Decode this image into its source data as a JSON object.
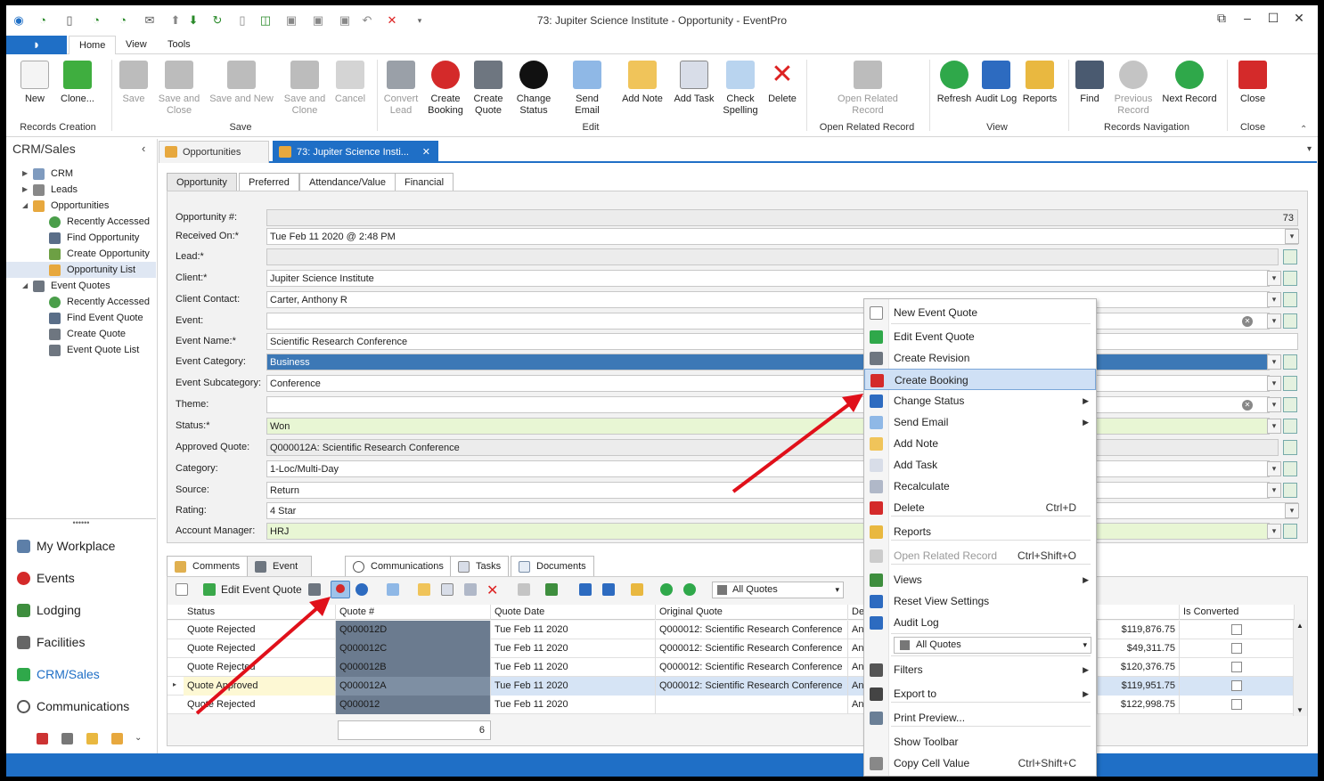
{
  "window": {
    "title": "73: Jupiter Science Institute - Opportunity - EventPro"
  },
  "menu": {
    "tabs": [
      "Home",
      "View",
      "Tools"
    ]
  },
  "ribbon": {
    "groups": [
      {
        "label": "Records Creation",
        "buttons": [
          "New",
          "Clone..."
        ]
      },
      {
        "label": "Save",
        "buttons": [
          "Save",
          "Save and Close",
          "Save and New",
          "Save and Clone",
          "Cancel"
        ]
      },
      {
        "label": "Edit",
        "buttons": [
          "Convert Lead",
          "Create Booking",
          "Create Quote",
          "Change Status",
          "Send Email",
          "Add Note",
          "Add Task",
          "Check Spelling",
          "Delete"
        ]
      },
      {
        "label": "Open Related Record",
        "buttons": [
          "Open Related Record"
        ]
      },
      {
        "label": "View",
        "buttons": [
          "Refresh",
          "Audit Log",
          "Reports"
        ]
      },
      {
        "label": "Records Navigation",
        "buttons": [
          "Find",
          "Previous Record",
          "Next Record"
        ]
      },
      {
        "label": "Close",
        "buttons": [
          "Close"
        ]
      }
    ]
  },
  "left_panel": {
    "title": "CRM/Sales",
    "tree": [
      "CRM",
      "Leads",
      "Opportunities",
      "Recently Accessed",
      "Find Opportunity",
      "Create Opportunity",
      "Opportunity List",
      "Event Quotes",
      "Recently Accessed",
      "Find Event Quote",
      "Create Quote",
      "Event Quote List"
    ],
    "nav": [
      "My Workplace",
      "Events",
      "Lodging",
      "Facilities",
      "CRM/Sales",
      "Communications"
    ]
  },
  "doc_tabs": [
    "Opportunities",
    "73: Jupiter Science Insti..."
  ],
  "form_tabs": [
    "Opportunity",
    "Preferred",
    "Attendance/Value",
    "Financial"
  ],
  "form": {
    "labels": [
      "Opportunity #:",
      "Received On:*",
      "Lead:*",
      "Client:*",
      "Client Contact:",
      "Event:",
      "Event Name:*",
      "Event Category:",
      "Event Subcategory:",
      "Theme:",
      "Status:*",
      "Approved Quote:",
      "Category:",
      "Source:",
      "Rating:",
      "Account Manager:"
    ],
    "values": [
      "73",
      "Tue Feb 11 2020 @ 2:48 PM",
      "",
      "Jupiter Science Institute",
      "Carter, Anthony R",
      "",
      "Scientific Research Conference",
      "Business",
      "Conference",
      "",
      "Won",
      "Q000012A: Scientific Research Conference",
      "1-Loc/Multi-Day",
      "Return",
      "4 Star",
      "HRJ"
    ]
  },
  "bottom_tabs": [
    "Comments",
    "Event Quotes",
    "Communications",
    "Tasks",
    "Documents"
  ],
  "grid": {
    "toolbar": {
      "edit_label": "Edit Event Quote",
      "filter": "All Quotes"
    },
    "columns": [
      "Status",
      "Quote #",
      "Quote Date",
      "Original Quote",
      "De",
      "Is Converted"
    ],
    "rows": [
      {
        "status": "Quote Rejected",
        "quote": "Q000012D",
        "date": "Tue Feb 11 2020",
        "orig": "Q000012: Scientific Research Conference",
        "de": "An",
        "amount": "$119,876.75"
      },
      {
        "status": "Quote Rejected",
        "quote": "Q000012C",
        "date": "Tue Feb 11 2020",
        "orig": "Q000012: Scientific Research Conference",
        "de": "An",
        "amount": "$49,311.75"
      },
      {
        "status": "Quote Rejected",
        "quote": "Q000012B",
        "date": "Tue Feb 11 2020",
        "orig": "Q000012: Scientific Research Conference",
        "de": "An",
        "amount": "$120,376.75"
      },
      {
        "status": "Quote Approved",
        "quote": "Q000012A",
        "date": "Tue Feb 11 2020",
        "orig": "Q000012: Scientific Research Conference",
        "de": "An",
        "amount": "$119,951.75"
      },
      {
        "status": "Quote Rejected",
        "quote": "Q000012",
        "date": "Tue Feb 11 2020",
        "orig": "",
        "de": "An",
        "amount": "$122,998.75"
      }
    ],
    "count": "6"
  },
  "context_menu": {
    "items": [
      {
        "label": "New Event Quote",
        "shortcut": ""
      },
      {
        "label": "Edit Event Quote",
        "shortcut": ""
      },
      {
        "label": "Create Revision",
        "shortcut": ""
      },
      {
        "label": "Create Booking",
        "shortcut": ""
      },
      {
        "label": "Change Status",
        "shortcut": ""
      },
      {
        "label": "Send Email",
        "shortcut": ""
      },
      {
        "label": "Add Note",
        "shortcut": ""
      },
      {
        "label": "Add Task",
        "shortcut": ""
      },
      {
        "label": "Recalculate",
        "shortcut": ""
      },
      {
        "label": "Delete",
        "shortcut": "Ctrl+D"
      },
      {
        "label": "Reports",
        "shortcut": ""
      },
      {
        "label": "Open Related Record",
        "shortcut": "Ctrl+Shift+O"
      },
      {
        "label": "Views",
        "shortcut": ""
      },
      {
        "label": "Reset View Settings",
        "shortcut": ""
      },
      {
        "label": "Audit Log",
        "shortcut": ""
      },
      {
        "label": "All Quotes",
        "shortcut": ""
      },
      {
        "label": "Filters",
        "shortcut": ""
      },
      {
        "label": "Export to",
        "shortcut": ""
      },
      {
        "label": "Print Preview...",
        "shortcut": ""
      },
      {
        "label": "Show Toolbar",
        "shortcut": ""
      },
      {
        "label": "Copy Cell Value",
        "shortcut": "Ctrl+Shift+C"
      }
    ]
  },
  "colors": {
    "accent": "#1f6fc6",
    "highlight_green": "#e8f6d4",
    "arrow": "#e0101a"
  }
}
